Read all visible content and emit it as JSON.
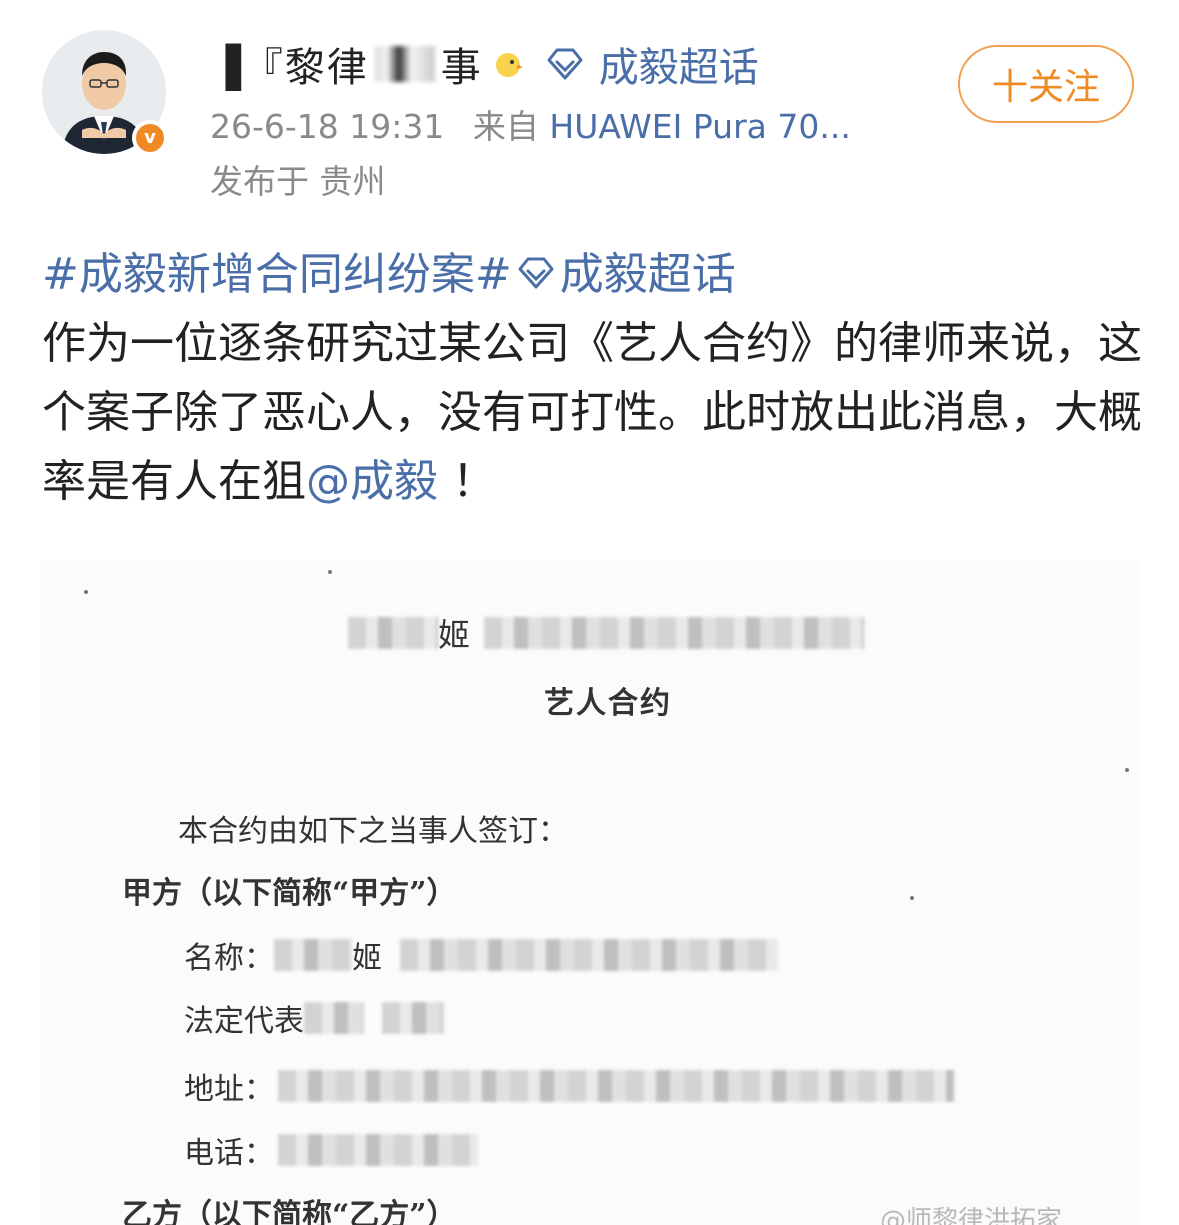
{
  "header": {
    "username": "律师黎律事",
    "username_parts": [
      "▐『黎律",
      "事"
    ],
    "supertopic": "成毅超话",
    "timestamp": "26-6-18 19:31",
    "source_prefix": "来自",
    "device": "HUAWEI Pura 70...",
    "location": "发布于 贵州",
    "follow_label": "十关注",
    "verified_badge": "v"
  },
  "post": {
    "hashtag": "#成毅新增合同纠纷案#",
    "supertopic_link": "成毅超话",
    "body": "作为一位逐条研究过某公司《艺人合约》的律师来说，这个案子除了恶心人，没有可打性。此时放出此消息，大概率是有人在狙",
    "mention": "@成毅",
    "ending": "！"
  },
  "document": {
    "heading_visible_char": "姬",
    "title": "艺人合约",
    "intro": "本合约由如下之当事人签订：",
    "party_a": "甲方（以下简称“甲方”）",
    "rows": [
      {
        "label": "名称：",
        "visible": "姬"
      },
      {
        "label": "法定代表",
        "visible": ""
      },
      {
        "label": "地址：",
        "visible": ""
      },
      {
        "label": "电话：",
        "visible": ""
      }
    ],
    "party_b": "乙方（以下简称“乙方”）"
  },
  "watermark": "@师黎律洪拓家"
}
